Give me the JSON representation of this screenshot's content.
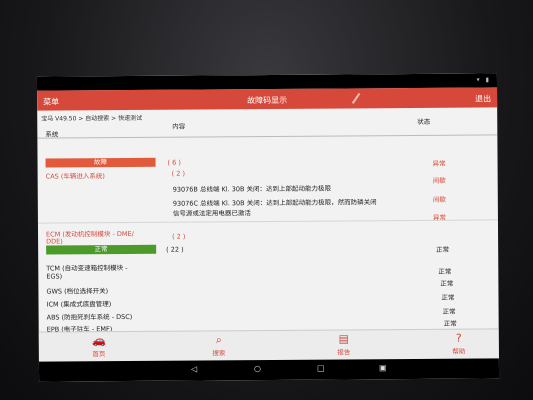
{
  "header": {
    "menu": "菜单",
    "title": "故障码显示",
    "exit": "退出"
  },
  "breadcrumb": "宝马 V49.50 > 自动搜索 > 快速测试",
  "columns": {
    "system": "系统",
    "content": "内容",
    "status": "状态"
  },
  "faults": {
    "label": "故障",
    "count": "( 6 )",
    "items": [
      {
        "system": "CAS (车辆进入系统)",
        "count": "( 2 )",
        "status": "异常"
      },
      {
        "content": "93076B 总线端 Kl. 30B 关闭：达到上部起动能力极限",
        "status": "间歇"
      },
      {
        "content": "93076C 总线端 Kl. 30B 关闭：达到上部起动能力极限，然而防磷关闭",
        "content2": "信号源或法定用电器已激活",
        "status": "间歇"
      },
      {
        "system": "ECM (发动机控制模块 - DME/",
        "system2": "DDE)",
        "count": "( 2 )",
        "status": "异常"
      }
    ]
  },
  "normals": {
    "label": "正常",
    "count": "( 22 )",
    "status": "正常",
    "items": [
      {
        "system": "TCM (自动变速箱控制模块 -",
        "system2": "EGS)",
        "status": "正常"
      },
      {
        "system": "GWS (档位选择开关)",
        "status": "正常"
      },
      {
        "system": "ICM (集成式底盘管理)",
        "status": "正常"
      },
      {
        "system": "ABS (防抱死刹车系统 - DSC)",
        "status": "正常"
      },
      {
        "system": "EPB (电子驻车 - EMF)",
        "status": "正常"
      }
    ]
  },
  "nav": [
    {
      "label": "首页",
      "icon": "car-icon"
    },
    {
      "label": "搜索",
      "icon": "search-icon"
    },
    {
      "label": "报告",
      "icon": "report-icon"
    },
    {
      "label": "帮助",
      "icon": "help-icon"
    }
  ],
  "colors": {
    "titlebar": "#d6493a",
    "fault": "#e15a3c",
    "normal": "#4c9a2a"
  }
}
